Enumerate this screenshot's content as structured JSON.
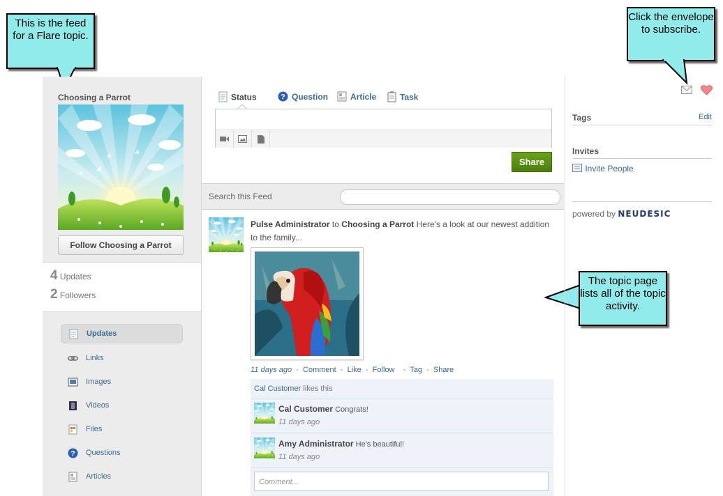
{
  "callouts": {
    "feed": "This is the feed for a Flare topic.",
    "subscribe": "Click the envelope to subscribe.",
    "activity": "The topic page lists all of the topic activity."
  },
  "topic": {
    "title": "Choosing a Parrot",
    "follow_label": "Follow Choosing a Parrot"
  },
  "stats": {
    "updates_count": "4",
    "updates_label": "Updates",
    "followers_count": "2",
    "followers_label": "Followers"
  },
  "nav": {
    "items": [
      {
        "label": "Updates",
        "icon": "document-icon"
      },
      {
        "label": "Links",
        "icon": "link-icon"
      },
      {
        "label": "Images",
        "icon": "image-icon"
      },
      {
        "label": "Videos",
        "icon": "video-icon"
      },
      {
        "label": "Files",
        "icon": "file-icon"
      },
      {
        "label": "Questions",
        "icon": "question-icon"
      },
      {
        "label": "Articles",
        "icon": "article-icon"
      }
    ]
  },
  "composer": {
    "tabs": [
      {
        "label": "Status",
        "icon": "document-icon"
      },
      {
        "label": "Question",
        "icon": "question-icon"
      },
      {
        "label": "Article",
        "icon": "article-icon"
      },
      {
        "label": "Task",
        "icon": "clipboard-icon"
      }
    ],
    "tools": [
      "video-icon",
      "image-icon",
      "file-icon"
    ],
    "share_label": "Share"
  },
  "search": {
    "label": "Search this Feed",
    "placeholder": ""
  },
  "post": {
    "author": "Pulse Administrator",
    "to": "to",
    "target": "Choosing a Parrot",
    "text": "Here's a look at our newest addition to the family...",
    "time": "11 days ago",
    "actions": [
      "Comment",
      "Like",
      "Follow",
      "Tag",
      "Share"
    ],
    "likes_user": "Cal Customer",
    "likes_text": "likes this",
    "comments": [
      {
        "author": "Cal Customer",
        "text": "Congrats!",
        "time": "11 days ago"
      },
      {
        "author": "Amy Administrator",
        "text": "He's beautiful!",
        "time": "11 days ago"
      }
    ],
    "comment_placeholder": "Comment..."
  },
  "sidebar": {
    "tags_heading": "Tags",
    "tags_edit": "Edit",
    "invites_heading": "Invites",
    "invite_label": "Invite People",
    "powered_by": "powered by",
    "brand": "NEUDESIC"
  },
  "colors": {
    "accent_blue": "#3d6a95",
    "share_green": "#5a9313",
    "callout": "#90ebea"
  }
}
